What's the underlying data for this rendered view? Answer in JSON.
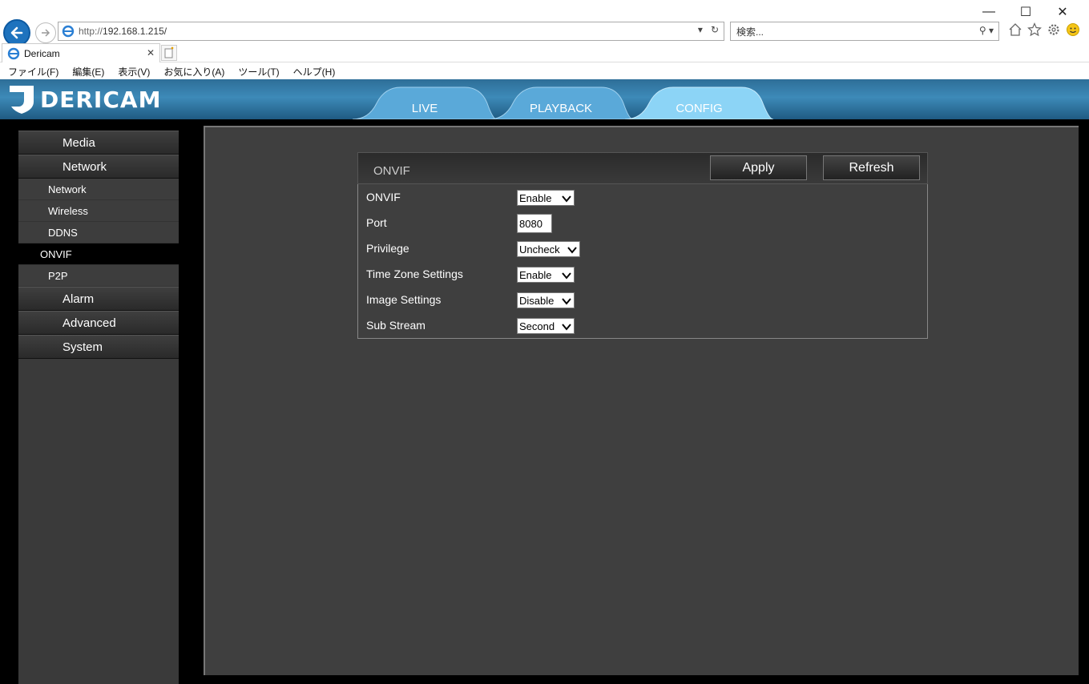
{
  "browser": {
    "url_protocol": "http://",
    "url_host": "192.168.1.215/",
    "search_placeholder": "検索...",
    "tab_title": "Dericam",
    "menu": [
      "ファイル(F)",
      "編集(E)",
      "表示(V)",
      "お気に入り(A)",
      "ツール(T)",
      "ヘルプ(H)"
    ]
  },
  "app": {
    "logo_text": "DERICAM",
    "nav_tabs": [
      "LIVE",
      "PLAYBACK",
      "CONFIG"
    ],
    "active_tab": "CONFIG",
    "accent_color": "#3d8ab8"
  },
  "sidebar": {
    "main_items": [
      "Media",
      "Network",
      "Alarm",
      "Advanced",
      "System"
    ],
    "network_sub_items": [
      "Network",
      "Wireless",
      "DDNS",
      "ONVIF",
      "P2P"
    ],
    "active_sub_item": "ONVIF"
  },
  "panel": {
    "title": "ONVIF",
    "apply_label": "Apply",
    "refresh_label": "Refresh",
    "fields": [
      {
        "label": "ONVIF",
        "value": "Enable",
        "type": "select"
      },
      {
        "label": "Port",
        "value": "8080",
        "type": "input"
      },
      {
        "label": "Privilege",
        "value": "Uncheck",
        "type": "select"
      },
      {
        "label": "Time Zone Settings",
        "value": "Enable",
        "type": "select"
      },
      {
        "label": "Image Settings",
        "value": "Disable",
        "type": "select"
      },
      {
        "label": "Sub Stream",
        "value": "Second",
        "type": "select"
      }
    ]
  }
}
